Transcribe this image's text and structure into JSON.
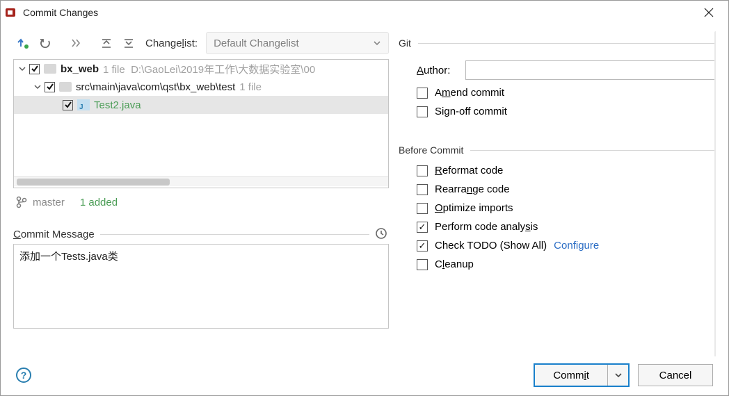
{
  "title": "Commit Changes",
  "toolbar": {
    "changelist_label": "Changelist:",
    "changelist_value": "Default Changelist"
  },
  "tree": {
    "root": {
      "name": "bx_web",
      "files_hint": "1 file",
      "path": "D:\\GaoLei\\2019年工作\\大数据实验室\\00"
    },
    "pkg": {
      "path": "src\\main\\java\\com\\qst\\bx_web\\test",
      "files_hint": "1 file"
    },
    "file": {
      "name": "Test2.java"
    }
  },
  "branch": {
    "name": "master",
    "added": "1 added"
  },
  "commit_message": {
    "label": "Commit Message",
    "value": "添加一个Tests.java类"
  },
  "git": {
    "section": "Git",
    "author_label": "Author:",
    "author_value": "",
    "amend": "Amend commit",
    "signoff": "Sign-off commit"
  },
  "before": {
    "section": "Before Commit",
    "reformat": "Reformat code",
    "rearrange": "Rearrange code",
    "optimize": "Optimize imports",
    "analyze": "Perform code analysis",
    "todo": "Check TODO (Show All)",
    "configure": "Configure",
    "cleanup": "Cleanup"
  },
  "buttons": {
    "commit": "Commit",
    "cancel": "Cancel"
  }
}
